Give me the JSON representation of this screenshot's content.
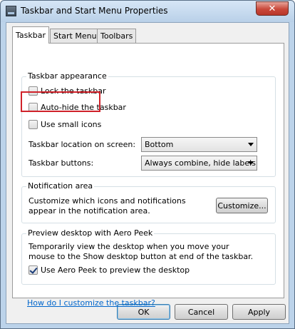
{
  "window": {
    "title": "Taskbar and Start Menu Properties",
    "close_symbol": "✕",
    "icon": "taskbar-icon"
  },
  "tabs": [
    {
      "label": "Taskbar",
      "active": true
    },
    {
      "label": "Start Menu",
      "active": false
    },
    {
      "label": "Toolbars",
      "active": false
    }
  ],
  "appearance": {
    "title": "Taskbar appearance",
    "lock": {
      "label": "Lock the taskbar",
      "checked": false
    },
    "autohide": {
      "label": "Auto-hide the taskbar",
      "checked": false
    },
    "small_icons": {
      "label": "Use small icons",
      "checked": false
    },
    "location": {
      "label": "Taskbar location on screen:",
      "value": "Bottom"
    },
    "buttons": {
      "label": "Taskbar buttons:",
      "value": "Always combine, hide labels"
    }
  },
  "notification": {
    "title": "Notification area",
    "text": "Customize which icons and notifications appear in the notification area.",
    "customize_label": "Customize..."
  },
  "peek": {
    "title": "Preview desktop with Aero Peek",
    "text": "Temporarily view the desktop when you move your mouse to the Show desktop button at end of the taskbar.",
    "checkbox": {
      "label": "Use Aero Peek to preview the desktop",
      "checked": true
    }
  },
  "help_link": "How do I customize the taskbar?",
  "buttons": {
    "ok": "OK",
    "cancel": "Cancel",
    "apply": "Apply"
  },
  "colors": {
    "highlight": "#d0222a",
    "link": "#0066cc",
    "close_button": "#c9483a"
  }
}
